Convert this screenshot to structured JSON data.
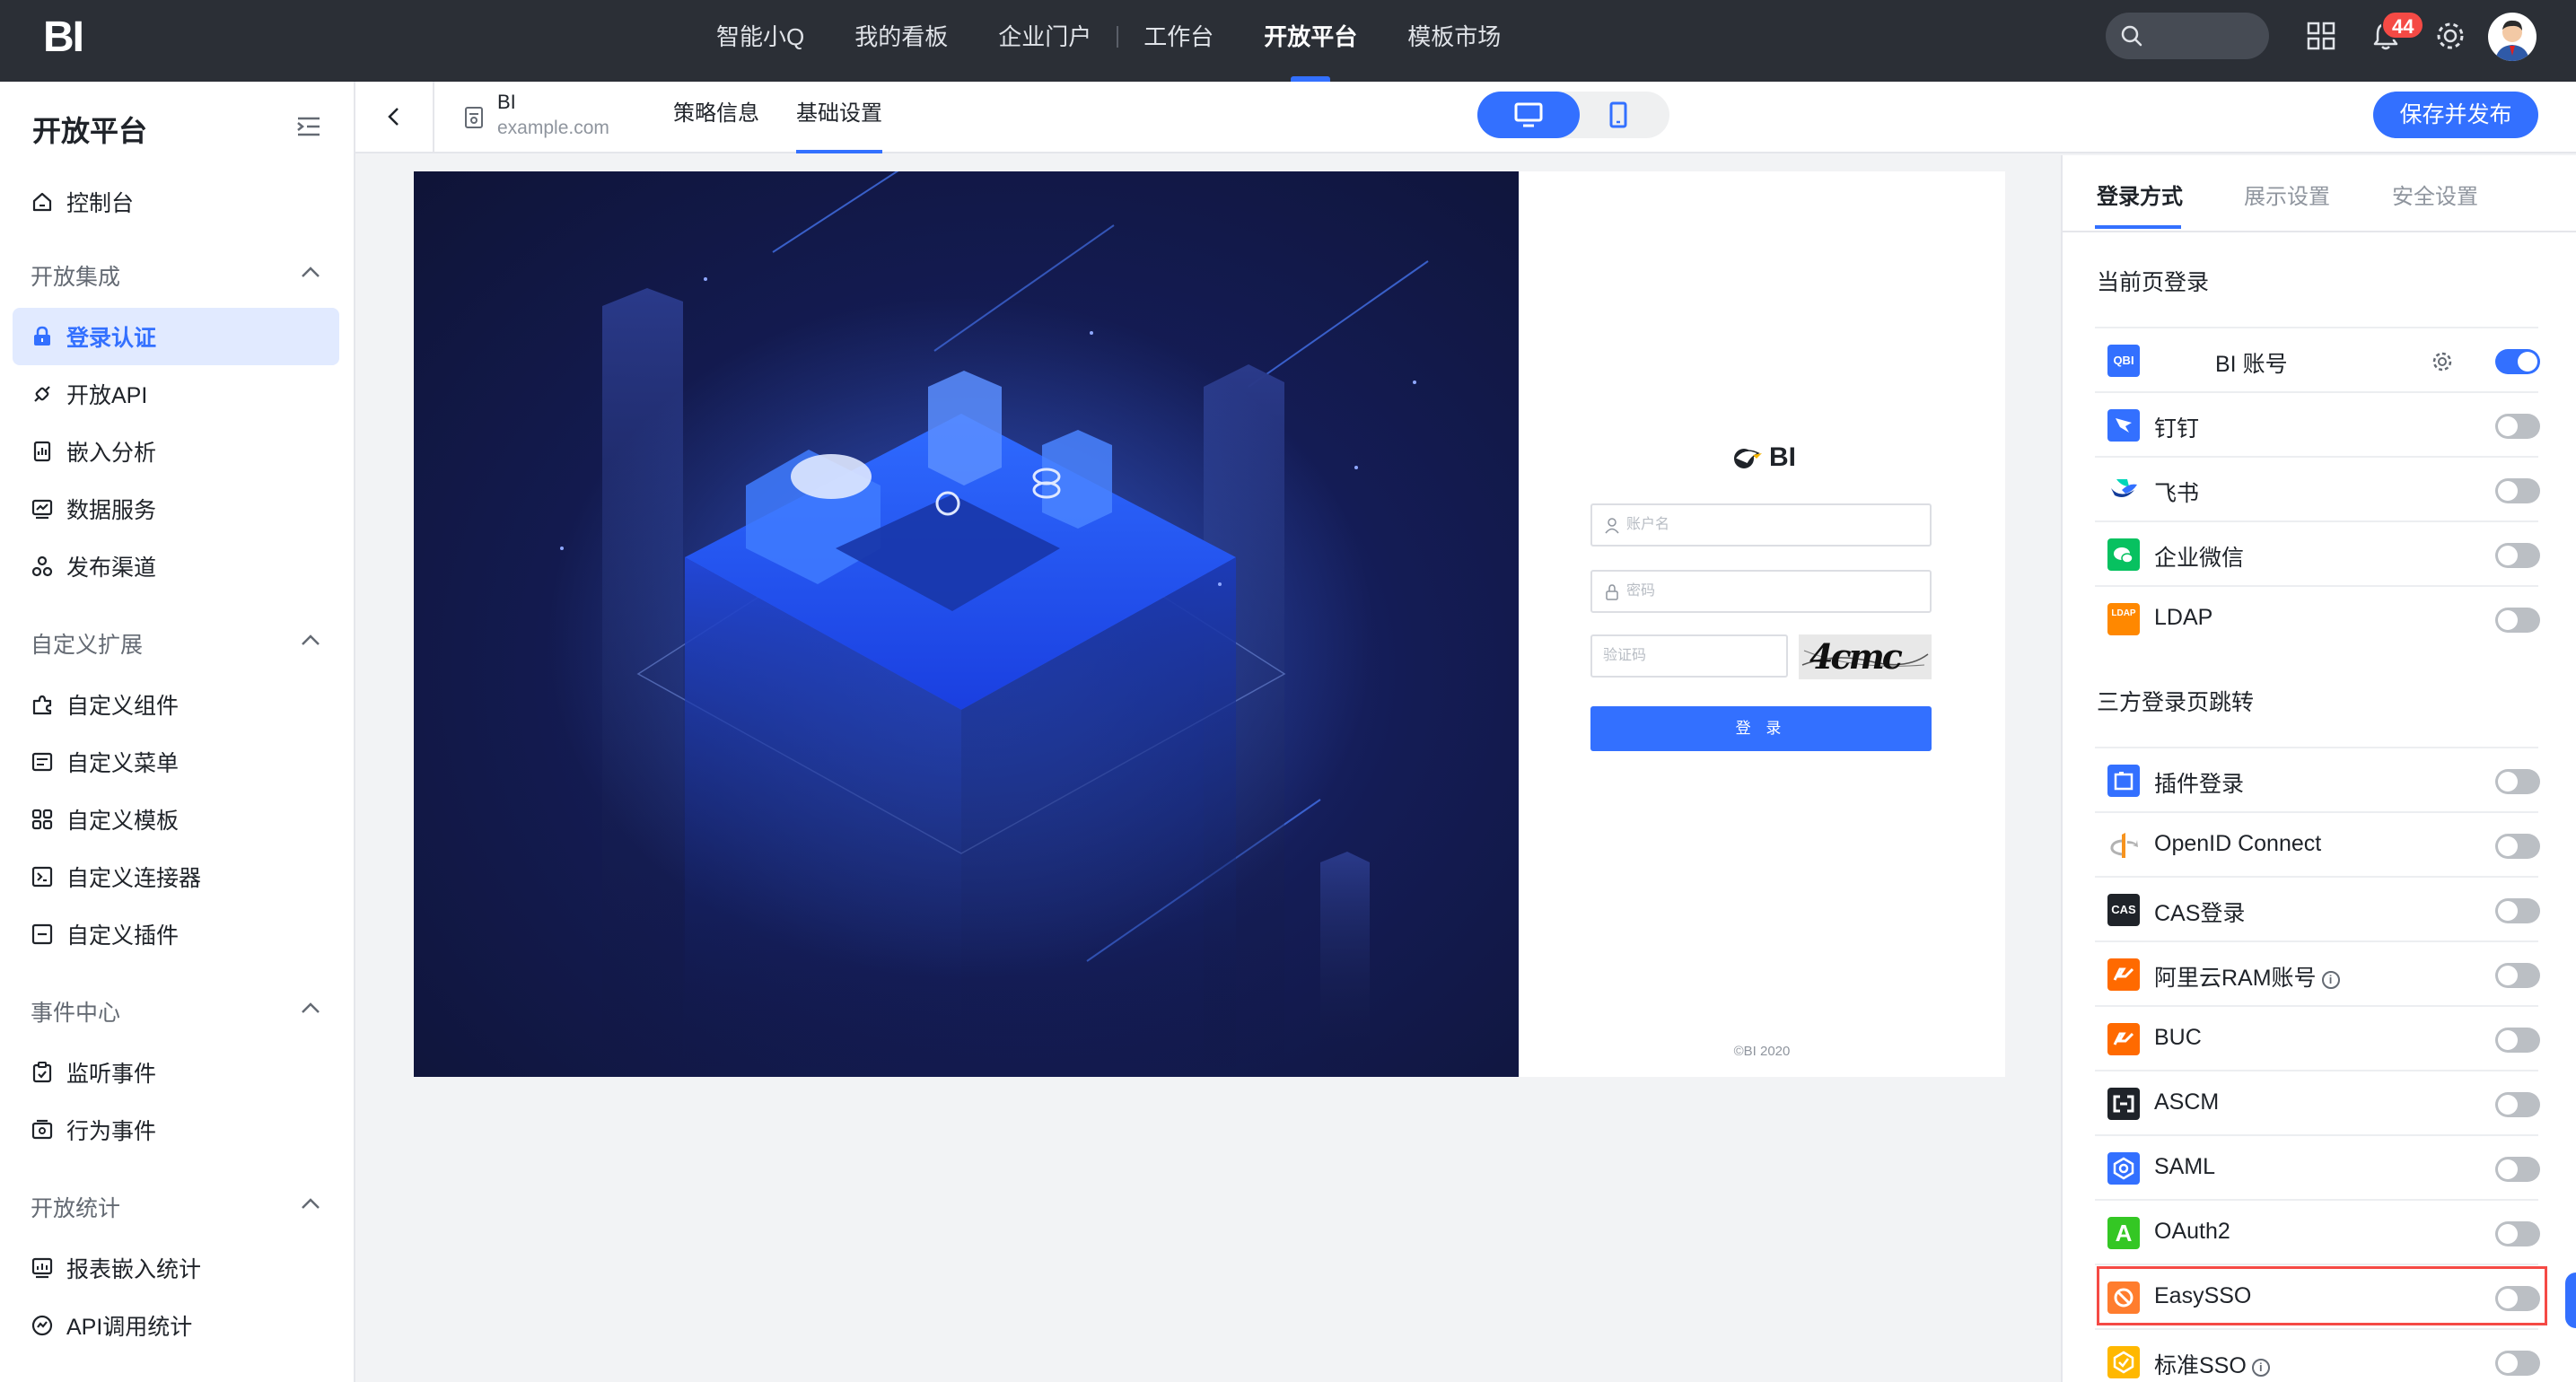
{
  "topbar": {
    "logo": "BI",
    "nav": [
      "智能小Q",
      "我的看板",
      "企业门户",
      "工作台",
      "开放平台",
      "模板市场"
    ],
    "active_nav": "开放平台",
    "notification_count": "44"
  },
  "sidebar": {
    "title": "开放平台",
    "home": "控制台",
    "groups": [
      {
        "label": "开放集成",
        "items": [
          "登录认证",
          "开放API",
          "嵌入分析",
          "数据服务",
          "发布渠道"
        ]
      },
      {
        "label": "自定义扩展",
        "items": [
          "自定义组件",
          "自定义菜单",
          "自定义模板",
          "自定义连接器",
          "自定义插件"
        ]
      },
      {
        "label": "事件中心",
        "items": [
          "监听事件",
          "行为事件"
        ]
      },
      {
        "label": "开放统计",
        "items": [
          "报表嵌入统计",
          "API调用统计"
        ]
      }
    ],
    "active_item": "登录认证"
  },
  "subheader": {
    "app_name": "BI",
    "app_domain": "example.com",
    "tabs": [
      "策略信息",
      "基础设置"
    ],
    "active_tab": "基础设置",
    "publish_button": "保存并发布"
  },
  "preview": {
    "brand": "BI",
    "username_placeholder": "账户名",
    "password_placeholder": "密码",
    "captcha_placeholder": "验证码",
    "captcha_text": "4cmc",
    "login_button": "登 录",
    "copyright": "©BI 2020"
  },
  "rpanel": {
    "tabs": [
      "登录方式",
      "展示设置",
      "安全设置"
    ],
    "active_tab": "登录方式",
    "section_current": "当前页登录",
    "current_items": [
      {
        "label": "BI 账号",
        "icon_text": "QBI",
        "color": "#3370ff",
        "on": true
      },
      {
        "label": "钉钉",
        "icon_text": "",
        "color": "#3370ff",
        "on": false
      },
      {
        "label": "飞书",
        "icon_text": "",
        "color": "#ffffff",
        "on": false
      },
      {
        "label": "企业微信",
        "icon_text": "",
        "color": "#07c160",
        "on": false
      },
      {
        "label": "LDAP",
        "icon_text": "LDAP",
        "color": "#ff8800",
        "on": false
      }
    ],
    "section_third": "三方登录页跳转",
    "third_items": [
      {
        "label": "插件登录",
        "icon_text": "",
        "color": "#3370ff",
        "on": false,
        "info": false
      },
      {
        "label": "OpenID Connect",
        "icon_text": "",
        "color": "#ffffff",
        "on": false,
        "info": false
      },
      {
        "label": "CAS登录",
        "icon_text": "CAS",
        "color": "#1f2329",
        "on": false,
        "info": false
      },
      {
        "label": "阿里云RAM账号",
        "icon_text": "",
        "color": "#ff6a00",
        "on": false,
        "info": true
      },
      {
        "label": "BUC",
        "icon_text": "",
        "color": "#ff6a00",
        "on": false,
        "info": false
      },
      {
        "label": "ASCM",
        "icon_text": "",
        "color": "#1f2329",
        "on": false,
        "info": false
      },
      {
        "label": "SAML",
        "icon_text": "",
        "color": "#3370ff",
        "on": false,
        "info": false
      },
      {
        "label": "OAuth2",
        "icon_text": "A",
        "color": "#34c724",
        "on": false,
        "info": false
      },
      {
        "label": "EasySSO",
        "icon_text": "",
        "color": "#ff7d2e",
        "on": false,
        "info": false
      },
      {
        "label": "标准SSO",
        "icon_text": "",
        "color": "#ffb800",
        "on": false,
        "info": true
      }
    ],
    "highlighted_item": "EasySSO"
  },
  "colors": {
    "accent": "#3370ff",
    "topbar": "#2b2f36",
    "highlight": "#f54a45"
  }
}
